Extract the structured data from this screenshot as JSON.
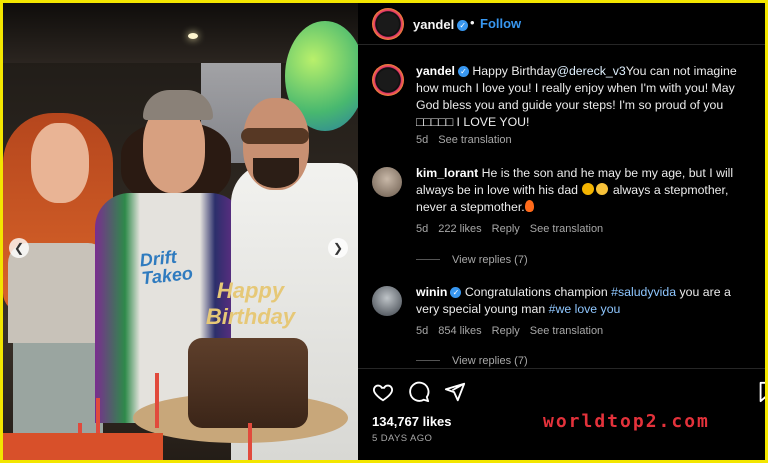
{
  "post": {
    "username": "yandel",
    "follow_label": "Follow",
    "separator": "•"
  },
  "photo": {
    "shirt_text": "Drift Takeo",
    "topper_text": "Happy Birthday"
  },
  "comments": [
    {
      "username": "yandel",
      "verified": true,
      "text_prefix": "Happy Birthday",
      "mention": "@dereck_v3",
      "text_suffix": "You can not imagine how much I love you! I really enjoy when I'm with you! May God bless you and guide your steps! I'm so proud of you □□□□□ I LOVE YOU!",
      "age": "5d",
      "translate": "See translation"
    },
    {
      "username": "kim_lorant",
      "verified": false,
      "text_a": "He is the son and he may be my age, but I will always be in love with his dad",
      "text_b": "always a stepmother, never a stepmother.",
      "age": "5d",
      "likes": "222 likes",
      "reply": "Reply",
      "translate": "See translation",
      "view_replies": "View replies (7)"
    },
    {
      "username": "winin",
      "verified": true,
      "text_prefix": "Congratulations champion",
      "hashtag1": "#saludyvida",
      "text_mid": "you are a very special young man",
      "hashtag2": "#we love you",
      "age": "5d",
      "likes": "854 likes",
      "reply": "Reply",
      "translate": "See translation",
      "view_replies": "View replies (7)"
    }
  ],
  "actions": {
    "like_count": "134,767 likes",
    "posted": "5 DAYS AGO",
    "icons": [
      "heart-icon",
      "comment-icon",
      "share-icon"
    ]
  },
  "watermark": "worldtop2.com",
  "colors": {
    "frame": "#f3e600",
    "background": "#000000",
    "link_blue": "#3897f0",
    "watermark_red": "#e3323b"
  }
}
